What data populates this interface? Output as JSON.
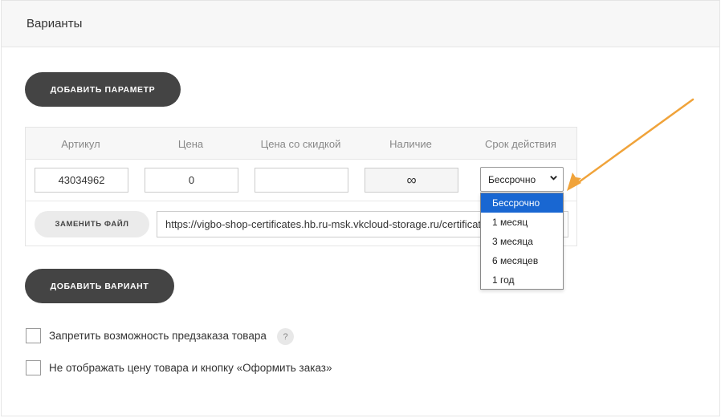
{
  "section": {
    "title": "Варианты"
  },
  "buttons": {
    "add_parameter": "ДОБАВИТЬ ПАРАМЕТР",
    "add_variant": "ДОБАВИТЬ ВАРИАНТ",
    "replace_file": "ЗАМЕНИТЬ ФАЙЛ"
  },
  "table": {
    "headers": [
      "Артикул",
      "Цена",
      "Цена со скидкой",
      "Наличие",
      "Срок действия"
    ],
    "row": {
      "sku": "43034962",
      "price": "0",
      "discount_price": "",
      "stock": "∞",
      "validity_selected": "Бессрочно"
    },
    "file_url": "https://vigbo-shop-certificates.hb.ru-msk.vkcloud-storage.ru/certificate-"
  },
  "validity_options": [
    "Бессрочно",
    "1 месяц",
    "3 месяца",
    "6 месяцев",
    "1 год"
  ],
  "checkboxes": {
    "no_preorder": "Запретить возможность предзаказа товара",
    "hide_price": "Не отображать цену товара и кнопку «Оформить заказ»"
  },
  "help": {
    "icon_text": "?"
  },
  "colors": {
    "dark_button": "#444444",
    "selected_option": "#1967d2",
    "annotation_arrow": "#f0a33a"
  }
}
